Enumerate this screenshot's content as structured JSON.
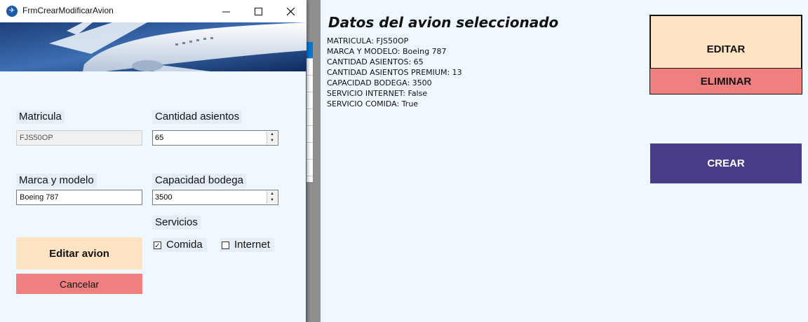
{
  "main": {
    "heading": "Datos del avion seleccionado",
    "info": [
      "MATRICULA: FJS50OP",
      "MARCA Y MODELO: Boeing 787",
      "CANTIDAD ASIENTOS: 65",
      "CANTIDAD ASIENTOS PREMIUM: 13",
      "CAPACIDAD BODEGA: 3500",
      "SERVICIO INTERNET: False",
      "SERVICIO COMIDA: True"
    ],
    "editar_label": "EDITAR",
    "eliminar_label": "ELIMINAR",
    "crear_label": "CREAR",
    "colors": {
      "editar": "#ffe4c4",
      "eliminar": "#f08080",
      "crear": "#483d8b"
    }
  },
  "dialog": {
    "title": "FrmCrearModificarAvion",
    "icons": {
      "app": "plane-icon",
      "minimize": "minimize-icon",
      "maximize": "maximize-icon",
      "close": "close-icon"
    },
    "matricula_label": "Matricula",
    "matricula_value": "FJS50OP",
    "asientos_label": "Cantidad asientos",
    "asientos_value": "65",
    "marca_label": "Marca y modelo",
    "marca_value": "Boeing 787",
    "bodega_label": "Capacidad bodega",
    "bodega_value": "3500",
    "servicios_label": "Servicios",
    "comida_label": "Comida",
    "comida_checked": true,
    "internet_label": "Internet",
    "internet_checked": false,
    "editar_avion_label": "Editar avion",
    "cancelar_label": "Cancelar"
  }
}
